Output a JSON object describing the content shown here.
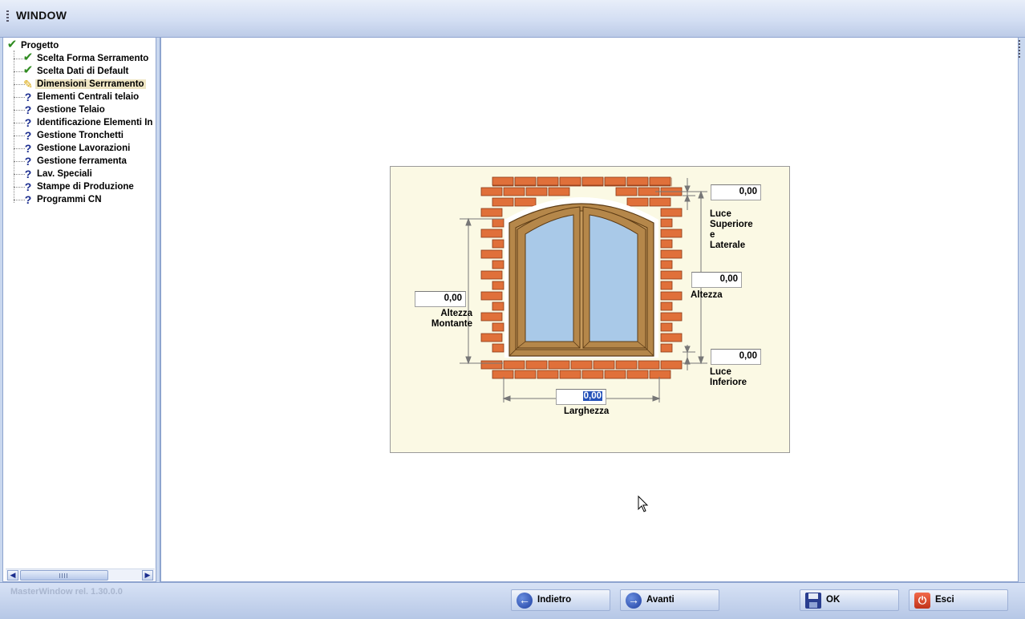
{
  "window": {
    "title": "WINDOW"
  },
  "tree": {
    "items": [
      {
        "label": "Progetto",
        "icon": "check-icon",
        "level": 0
      },
      {
        "label": "Scelta Forma Serramento",
        "icon": "check-icon",
        "level": 1
      },
      {
        "label": "Scelta Dati di Default",
        "icon": "check-icon",
        "level": 1
      },
      {
        "label": "Dimensioni Serrramento",
        "icon": "pencil-icon",
        "level": 1,
        "selected": true
      },
      {
        "label": "Elementi Centrali telaio",
        "icon": "question-icon",
        "level": 1
      },
      {
        "label": "Gestione Telaio",
        "icon": "question-icon",
        "level": 1
      },
      {
        "label": "Identificazione Elementi In",
        "icon": "question-icon",
        "level": 1
      },
      {
        "label": "Gestione Tronchetti",
        "icon": "question-icon",
        "level": 1
      },
      {
        "label": "Gestione Lavorazioni",
        "icon": "question-icon",
        "level": 1
      },
      {
        "label": "Gestione ferramenta",
        "icon": "question-icon",
        "level": 1
      },
      {
        "label": "Lav. Speciali",
        "icon": "question-icon",
        "level": 1
      },
      {
        "label": "Stampe di Produzione",
        "icon": "question-icon",
        "level": 1
      },
      {
        "label": "Programmi CN",
        "icon": "question-icon",
        "level": 1
      }
    ]
  },
  "form": {
    "luce_superiore": {
      "value": "0,00",
      "label_lines": [
        "Luce",
        "Superiore",
        "e",
        "Laterale"
      ]
    },
    "altezza": {
      "value": "0,00",
      "label": "Altezza"
    },
    "luce_inferiore": {
      "value": "0,00",
      "label_lines": [
        "Luce",
        "Inferiore"
      ]
    },
    "altezza_montante": {
      "value": "0,00",
      "label_lines": [
        "Altezza",
        "Montante"
      ]
    },
    "larghezza": {
      "value": "0,00",
      "label": "Larghezza"
    }
  },
  "status": {
    "version": "MasterWindow rel. 1.30.0.0"
  },
  "buttons": {
    "indietro": "Indietro",
    "avanti": "Avanti",
    "ok": "OK",
    "esci": "Esci"
  },
  "colors": {
    "brick": "#e0703a",
    "frame_wood": "#b5874a",
    "glass": "#a9c9e8",
    "diagram_bg": "#fbf9e4"
  }
}
